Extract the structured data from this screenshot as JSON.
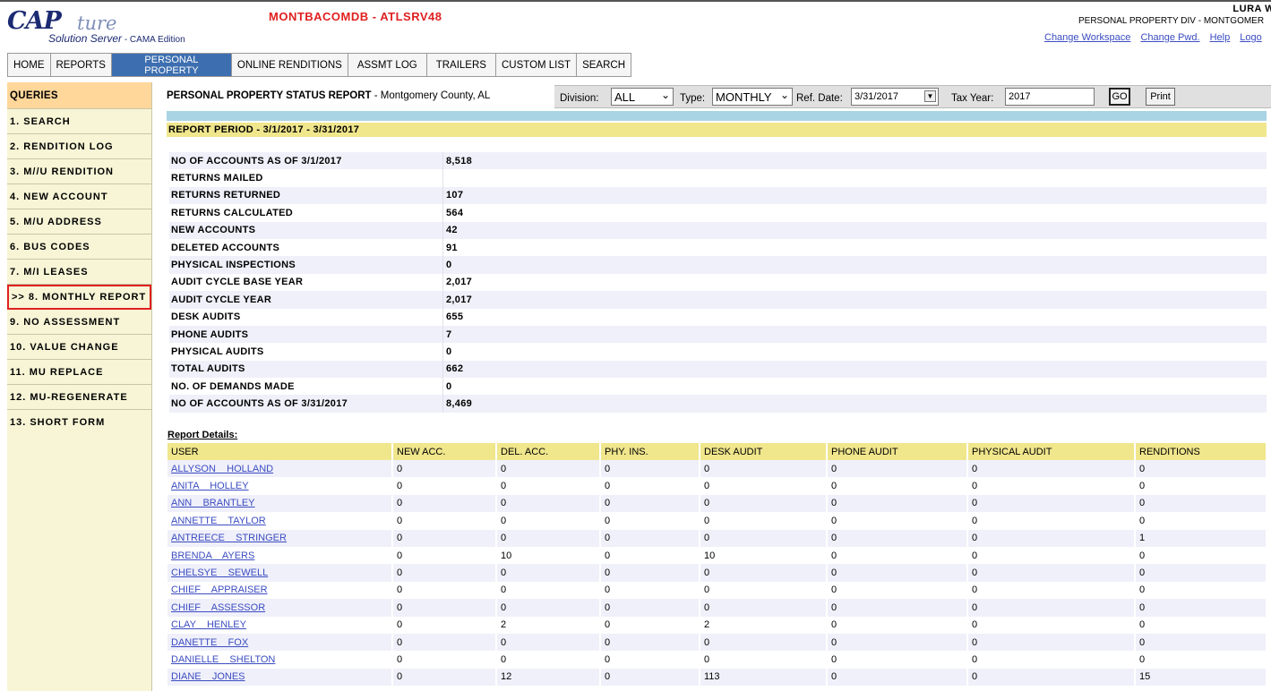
{
  "header": {
    "logo_main": "CAP",
    "logo_script": "ture",
    "logo_sub": "Solution Server",
    "logo_edition": " - CAMA Edition",
    "db_name": "MONTBACOMDB - ATLSRV48",
    "user_name": "LURA  W",
    "user_division": "PERSONAL PROPERTY DIV  -  MONTGOMER",
    "links": [
      "Change Workspace",
      "Change Pwd.",
      "Help",
      "Logo"
    ]
  },
  "nav": {
    "tabs": [
      "HOME",
      "REPORTS",
      "ONLINE RENDITIONS",
      "ASSMT LOG",
      "TRAILERS",
      "CUSTOM LIST",
      "SEARCH"
    ],
    "active_line1": "PERSONAL",
    "active_line2": "PROPERTY"
  },
  "sidebar": {
    "heading": "QUERIES",
    "items": [
      "1. SEARCH",
      "2. RENDITION LOG",
      "3. M//U RENDITION",
      "4. NEW ACCOUNT",
      "5. M/U ADDRESS",
      "6. BUS CODES",
      "7. M/I LEASES",
      ">> 8. MONTHLY REPORT",
      "9. NO ASSESSMENT",
      "10. VALUE CHANGE",
      "11. MU REPLACE",
      "12. MU-REGENERATE",
      "13. SHORT FORM"
    ],
    "selected_index": 7
  },
  "report": {
    "title": "PERSONAL PROPERTY STATUS REPORT",
    "county": " - Montgomery County, AL",
    "period": "REPORT PERIOD - 3/1/2017 - 3/31/2017",
    "details_label": "Report Details:"
  },
  "filters": {
    "division_label": "Division:",
    "division_value": "ALL",
    "type_label": "Type:",
    "type_value": "MONTHLY",
    "refdate_label": "Ref. Date:",
    "refdate_value": "3/31/2017",
    "taxyear_label": "Tax Year:",
    "taxyear_value": "2017",
    "go_label": "GO",
    "print_label": "Print"
  },
  "summary": [
    {
      "label": "NO OF ACCOUNTS AS OF 3/1/2017",
      "value": "8,518"
    },
    {
      "label": "RETURNS MAILED",
      "value": ""
    },
    {
      "label": "RETURNS RETURNED",
      "value": "107"
    },
    {
      "label": "RETURNS CALCULATED",
      "value": "564"
    },
    {
      "label": "NEW ACCOUNTS",
      "value": "42"
    },
    {
      "label": "DELETED ACCOUNTS",
      "value": "91"
    },
    {
      "label": "PHYSICAL INSPECTIONS",
      "value": "0"
    },
    {
      "label": "AUDIT CYCLE BASE YEAR",
      "value": "2,017"
    },
    {
      "label": "AUDIT CYCLE YEAR",
      "value": "2,017"
    },
    {
      "label": "DESK AUDITS",
      "value": "655"
    },
    {
      "label": "PHONE AUDITS",
      "value": "7"
    },
    {
      "label": "PHYSICAL AUDITS",
      "value": "0"
    },
    {
      "label": "TOTAL AUDITS",
      "value": "662"
    },
    {
      "label": "NO. OF DEMANDS MADE",
      "value": "0"
    },
    {
      "label": "NO OF ACCOUNTS AS OF 3/31/2017",
      "value": "8,469"
    }
  ],
  "details": {
    "columns": [
      "USER",
      "NEW ACC.",
      "DEL. ACC.",
      "PHY. INS.",
      "DESK AUDIT",
      "PHONE AUDIT",
      "PHYSICAL AUDIT",
      "RENDITIONS"
    ],
    "rows": [
      [
        "ALLYSON    HOLLAND",
        "0",
        "0",
        "0",
        "0",
        "0",
        "0",
        "0"
      ],
      [
        "ANITA    HOLLEY",
        "0",
        "0",
        "0",
        "0",
        "0",
        "0",
        "0"
      ],
      [
        "ANN    BRANTLEY",
        "0",
        "0",
        "0",
        "0",
        "0",
        "0",
        "0"
      ],
      [
        "ANNETTE    TAYLOR",
        "0",
        "0",
        "0",
        "0",
        "0",
        "0",
        "0"
      ],
      [
        "ANTREECE    STRINGER",
        "0",
        "0",
        "0",
        "0",
        "0",
        "0",
        "1"
      ],
      [
        "BRENDA    AYERS",
        "0",
        "10",
        "0",
        "10",
        "0",
        "0",
        "0"
      ],
      [
        "CHELSYE    SEWELL",
        "0",
        "0",
        "0",
        "0",
        "0",
        "0",
        "0"
      ],
      [
        "CHIEF    APPRAISER",
        "0",
        "0",
        "0",
        "0",
        "0",
        "0",
        "0"
      ],
      [
        "CHIEF    ASSESSOR",
        "0",
        "0",
        "0",
        "0",
        "0",
        "0",
        "0"
      ],
      [
        "CLAY    HENLEY",
        "0",
        "2",
        "0",
        "2",
        "0",
        "0",
        "0"
      ],
      [
        "DANETTE    FOX",
        "0",
        "0",
        "0",
        "0",
        "0",
        "0",
        "0"
      ],
      [
        "DANIELLE    SHELTON",
        "0",
        "0",
        "0",
        "0",
        "0",
        "0",
        "0"
      ],
      [
        "DIANE    JONES",
        "0",
        "12",
        "0",
        "113",
        "0",
        "0",
        "15"
      ]
    ]
  }
}
